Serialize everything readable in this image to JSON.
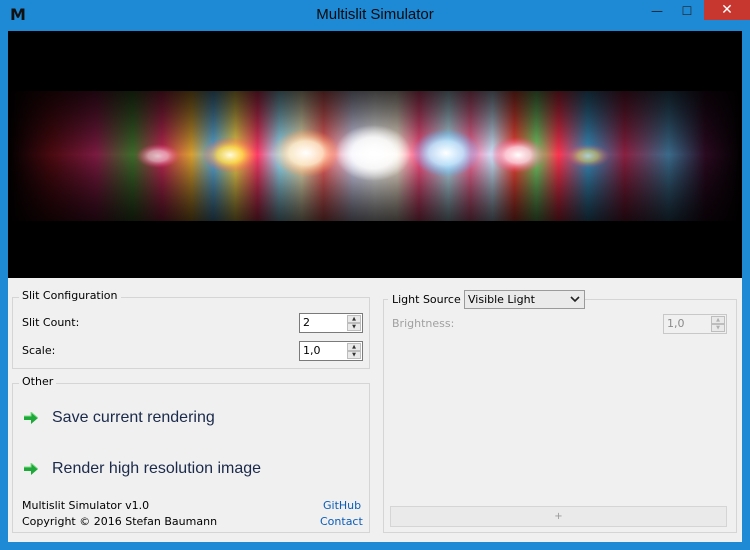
{
  "window": {
    "title": "Multislit Simulator",
    "app_icon_glyph": "M",
    "min_glyph": "—",
    "max_glyph": "☐",
    "close_glyph": "✕"
  },
  "slit_config": {
    "legend": "Slit Configuration",
    "slit_count_label": "Slit Count:",
    "slit_count_value": "2",
    "scale_label": "Scale:",
    "scale_value": "1,0"
  },
  "other": {
    "legend": "Other",
    "save_label": "Save current rendering",
    "render_label": "Render high resolution image",
    "app_version": "Multislit Simulator v1.0",
    "copyright": "Copyright © 2016 Stefan Baumann",
    "github_link": "GitHub",
    "contact_link": "Contact"
  },
  "light_source": {
    "legend": "Light Source",
    "selected": "Visible Light",
    "brightness_label": "Brightness:",
    "brightness_value": "1,0",
    "add_button": "+"
  },
  "icons": {
    "arrow": "green-arrow-icon",
    "spin_up": "▲",
    "spin_down": "▼",
    "chevron": "⌄"
  },
  "colors": {
    "titlebar": "#1e8ad6",
    "close_button": "#c7372f",
    "client_bg": "#f0f0f0",
    "arrow_green": "#1fa83a",
    "link": "#0b5db8"
  }
}
